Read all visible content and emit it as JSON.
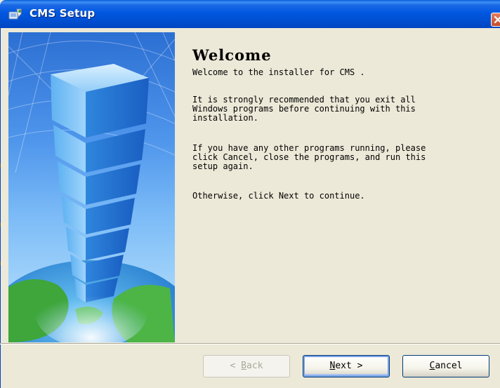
{
  "window": {
    "title": "CMS Setup",
    "title_icon": "installer-icon",
    "close_icon": "close-icon",
    "accent_color": "#0054e3"
  },
  "content": {
    "heading": "Welcome",
    "intro": "Welcome to the installer for CMS .",
    "recommend": "It is strongly recommended that you exit all\nWindows programs before continuing with this\ninstallation.",
    "running": "If you have any other programs running, please\nclick Cancel, close the programs, and run this\nsetup again.",
    "otherwise": "Otherwise, click Next to continue."
  },
  "buttons": {
    "back": {
      "prefix": "< ",
      "accel": "B",
      "rest": "ack",
      "enabled": false
    },
    "next": {
      "prefix": "",
      "accel": "N",
      "rest": "ext >",
      "enabled": true
    },
    "cancel": {
      "prefix": "",
      "accel": "C",
      "rest": "ancel",
      "enabled": true
    }
  }
}
